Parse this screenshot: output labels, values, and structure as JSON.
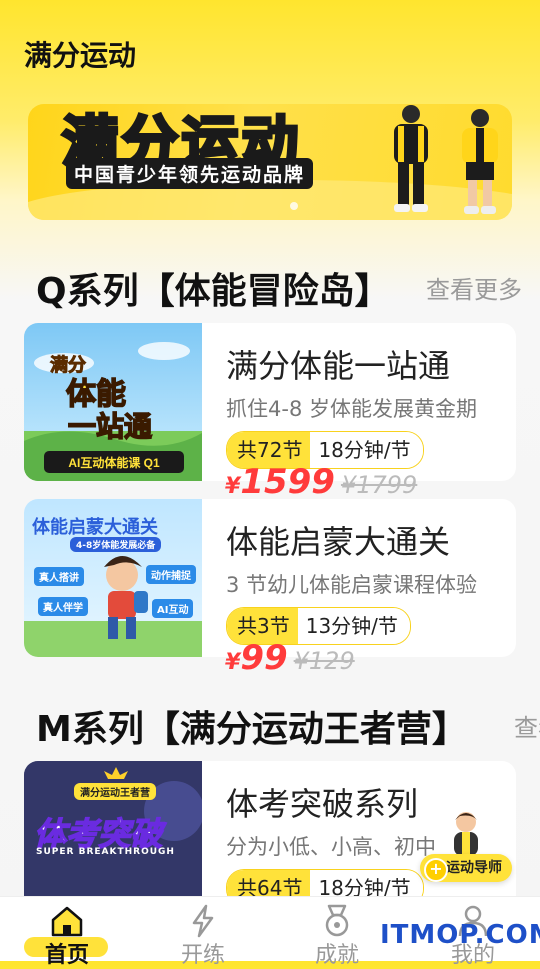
{
  "app": {
    "title": "满分运动"
  },
  "banner": {
    "title": "满分运动",
    "subtitle": "中国青少年领先运动品牌"
  },
  "sections": [
    {
      "title": "Q系列【体能冒险岛】",
      "more": "查看更多"
    },
    {
      "title": "M系列【满分运动王者营】",
      "more": "查看更多"
    }
  ],
  "courses": [
    {
      "title": "满分体能一站通",
      "desc": "抓住4-8 岁体能发展黄金期",
      "lessons": "共72节",
      "duration": "18分钟/节",
      "currency": "¥",
      "price": "1599",
      "old_price": "¥1799",
      "thumb": {
        "line1": "满分",
        "line2": "体能",
        "line3": "一站通",
        "footer": "AI互动体能课 Q1"
      }
    },
    {
      "title": "体能启蒙大通关",
      "desc": "3 节幼儿体能启蒙课程体验",
      "lessons": "共3节",
      "duration": "13分钟/节",
      "currency": "¥",
      "price": "99",
      "old_price": "¥129",
      "thumb": {
        "heading": "体能启蒙大通关",
        "sub": "4-8岁体能发展必备",
        "chip1": "真人搭讲",
        "chip2": "动作捕捉",
        "chip3": "真人伴学",
        "chip4": "AI互动"
      }
    },
    {
      "title": "体考突破系列",
      "desc": "分为小低、小高、初中",
      "lessons": "共64节",
      "duration": "18分钟/节",
      "thumb": {
        "badge": "满分运动王者营",
        "heading": "体考突破",
        "sub": "SUPER BREAKTHROUGH"
      }
    }
  ],
  "guide": {
    "label": "运动导师"
  },
  "nav": [
    {
      "label": "首页",
      "icon": "home-icon",
      "active": true
    },
    {
      "label": "开练",
      "icon": "lightning-icon",
      "active": false
    },
    {
      "label": "成就",
      "icon": "medal-icon",
      "active": false
    },
    {
      "label": "我的",
      "icon": "user-icon",
      "active": false
    }
  ],
  "watermark": "ITMOP.COM",
  "colors": {
    "accent": "#FFE23A",
    "price": "#FF3B3B"
  }
}
